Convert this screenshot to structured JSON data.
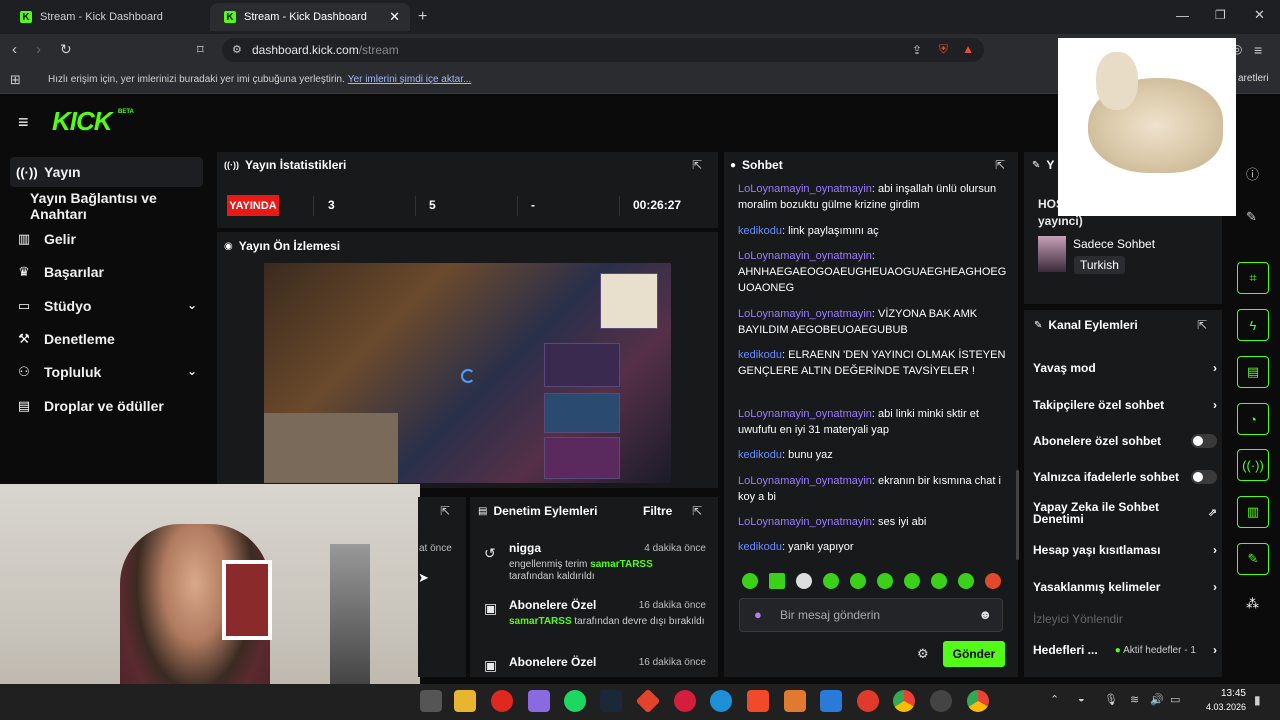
{
  "browser": {
    "tabs": [
      {
        "title": "Stream - Kick Dashboard"
      },
      {
        "title": "Stream - Kick Dashboard"
      }
    ],
    "url_host": "dashboard.kick.com",
    "url_path": "/stream",
    "bookmarks_text": "Hızlı erişim için, yer imlerinizi buradaki yer imi çubuğuna yerleştirin.",
    "bookmarks_link": "Yer imlerini şimdi içe aktar...",
    "bookmarks_right": "aretleri"
  },
  "brand": {
    "logo": "KICK",
    "badge": "BETA"
  },
  "sidebar": {
    "items": [
      {
        "label": "Yayın",
        "icon": "broadcast-icon"
      },
      {
        "label": "Yayın Bağlantısı ve Anahtarı",
        "icon": ""
      },
      {
        "label": "Gelir",
        "icon": "chart-icon"
      },
      {
        "label": "Başarılar",
        "icon": "trophy-icon"
      },
      {
        "label": "Stüdyo",
        "icon": "studio-icon"
      },
      {
        "label": "Denetleme",
        "icon": "hammer-icon"
      },
      {
        "label": "Topluluk",
        "icon": "people-icon"
      },
      {
        "label": "Droplar ve ödüller",
        "icon": "gift-icon"
      }
    ]
  },
  "stats": {
    "title": "Yayın İstatistikleri",
    "status": "YAYINDA",
    "viewers": "3",
    "followers": "5",
    "subs": "-",
    "uptime": "00:26:27"
  },
  "preview": {
    "title": "Yayın Ön İzlemesi"
  },
  "webcam_overlay": {
    "time_fragment": "at önce"
  },
  "modlog": {
    "title": "Denetim Eylemleri",
    "filter": "Filtre",
    "items": [
      {
        "title": "nigga",
        "time": "4 dakika önce",
        "pre": "engellenmiş terim ",
        "user": "samarTARSS",
        "post": "tarafından kaldırıldı"
      },
      {
        "title": "Abonelere Özel",
        "time": "16 dakika önce",
        "pre": "",
        "user": "samarTARSS",
        "post": " tarafından devre dışı bırakıldı"
      },
      {
        "title": "Abonelere Özel",
        "time": "16 dakika önce",
        "pre": "",
        "user": "",
        "post": ""
      }
    ]
  },
  "chat": {
    "title": "Sohbet",
    "messages": [
      {
        "user": "LoLoynamayin_oynatmayin",
        "text": ": abi inşallah ünlü olursun moralim bozuktu gülme krizine girdim"
      },
      {
        "user": "kedikodu",
        "text": ": link paylaşımını aç"
      },
      {
        "user": "LoLoynamayin_oynatmayin",
        "text": ": AHNHAEGAEOGOAEUGHEUAOGUAEGHEAGHOEG UOAONEG"
      },
      {
        "user": "LoLoynamayin_oynatmayin",
        "text": ": VİZYONA BAK AMK BAYILDIM AEGOBEUOAEGUBUB"
      },
      {
        "user": "kedikodu",
        "text": ": ELRAENN 'DEN YAYINCI OLMAK İSTEYEN GENÇLERE ALTIN DEĞERİNDE TAVSİYELER !"
      },
      {
        "user": "LoLoynamayin_oynatmayin",
        "text": ": abi linki minki sktir et uwufufu en iyi 31 materyali yap"
      },
      {
        "user": "kedikodu",
        "text": ": bunu yaz"
      },
      {
        "user": "LoLoynamayin_oynatmayin",
        "text": ": ekranın bir kısmına chat i koy a bi"
      },
      {
        "user": "LoLoynamayin_oynatmayin",
        "text": ": ses iyi abi"
      },
      {
        "user": "kedikodu",
        "text": ": yankı yapıyor"
      }
    ],
    "input_placeholder": "Bir mesaj gönderin",
    "send": "Gönder"
  },
  "stream_info": {
    "title_frag": "HOŞ",
    "title_frag2": "yayınci)",
    "header_frag": "Y",
    "category": "Sadece Sohbet",
    "language": "Turkish"
  },
  "channel_actions": {
    "title": "Kanal Eylemleri",
    "rows": [
      {
        "label": "Yavaş mod",
        "type": "arrow"
      },
      {
        "label": "Takipçilere özel sohbet",
        "type": "arrow"
      },
      {
        "label": "Abonelere özel sohbet",
        "type": "toggle"
      },
      {
        "label": "Yalnızca ifadelerle sohbet",
        "type": "toggle"
      },
      {
        "label": "Yapay Zeka ile Sohbet Denetimi",
        "type": "external"
      },
      {
        "label": "Hesap yaşı kısıtlaması",
        "type": "arrow"
      },
      {
        "label": "Yasaklanmış kelimeler",
        "type": "arrow"
      }
    ],
    "redirect": "İzleyici Yönlendir",
    "goals": "Hedefleri ...",
    "goals_status": "Aktif hedefler - 1"
  },
  "taskbar": {
    "time": "13:45",
    "date": "4.03.2026"
  },
  "colors": {
    "accent": "#53fc18",
    "live": "#e91916",
    "chat_user1": "#9b7bff",
    "chat_user2": "#6a8dff"
  }
}
